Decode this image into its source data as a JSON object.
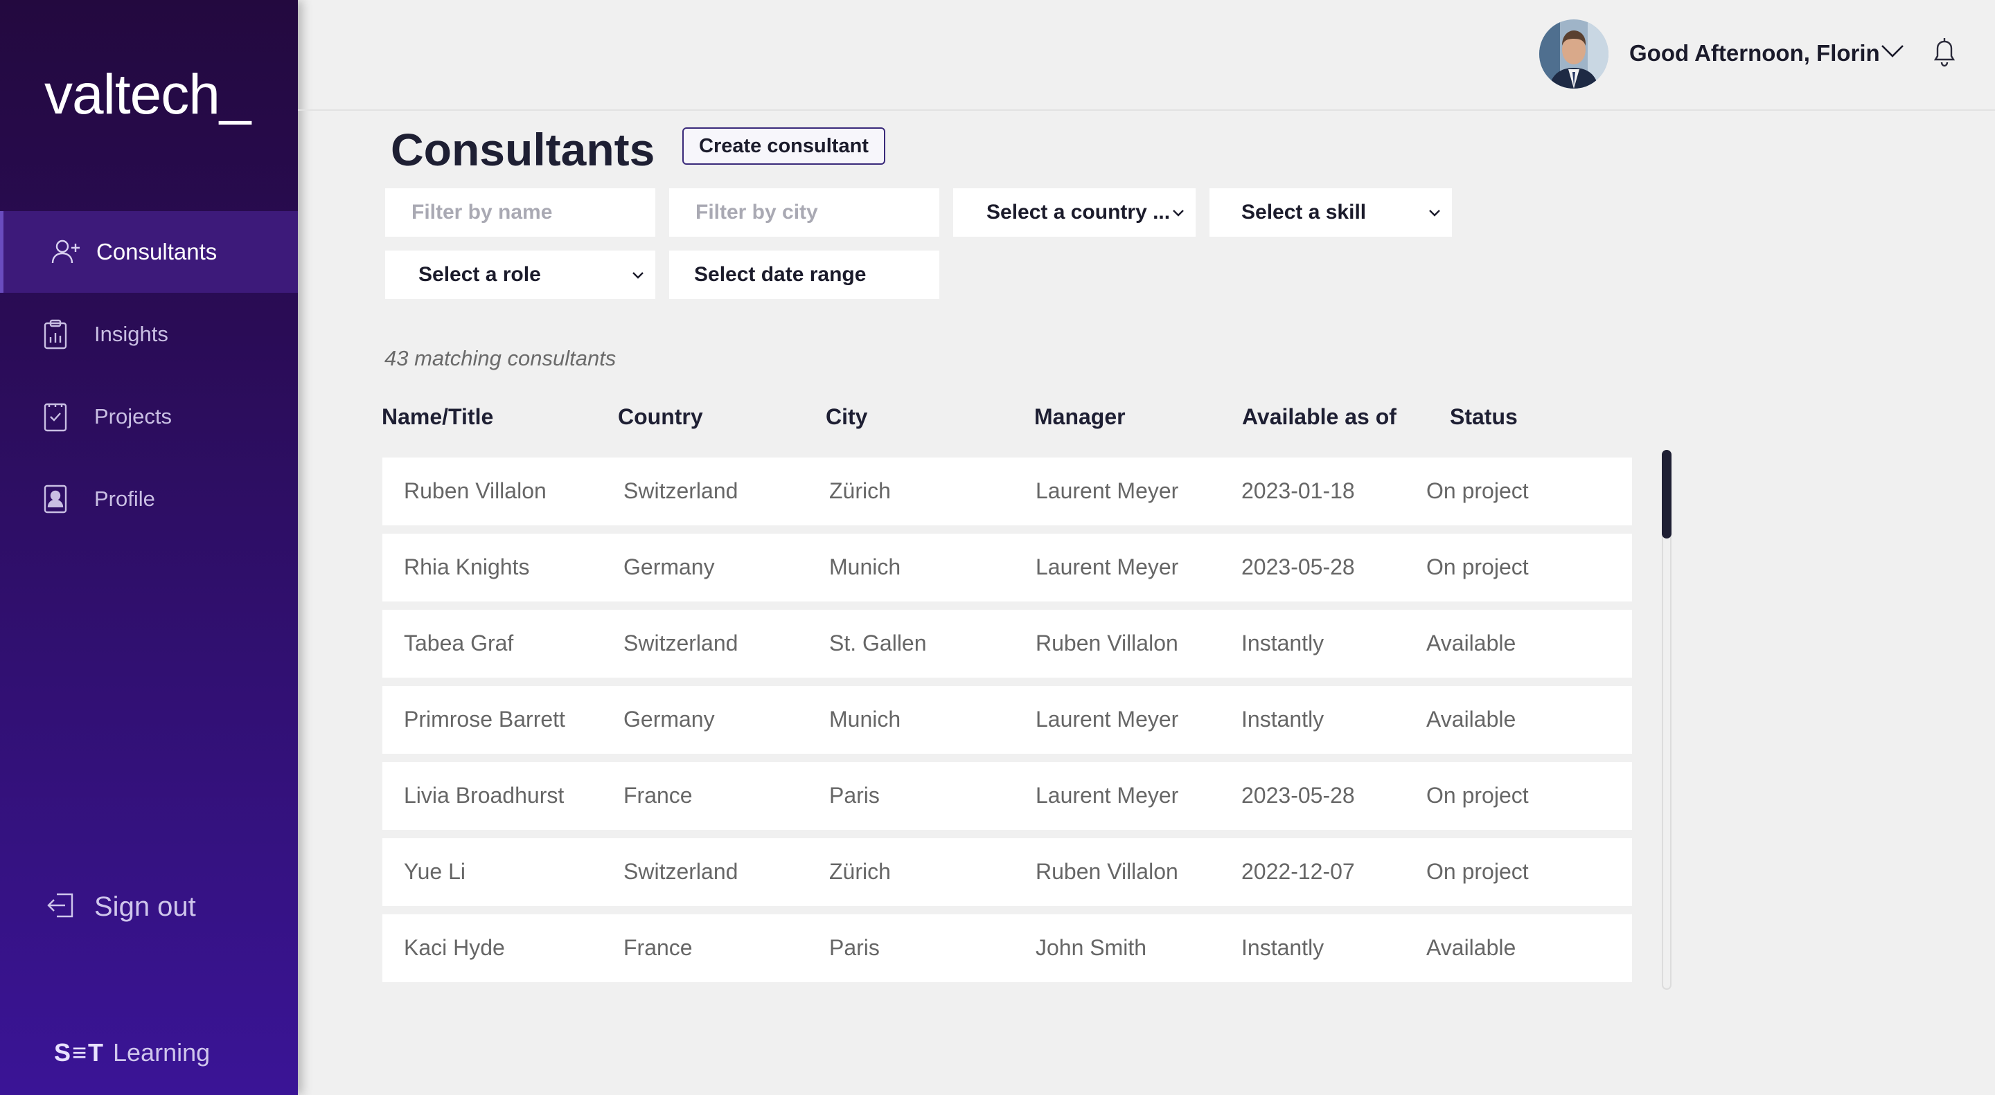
{
  "sidebar": {
    "logo": "valtech_",
    "items": [
      {
        "label": "Consultants",
        "icon": "user-plus-icon"
      },
      {
        "label": "Insights",
        "icon": "clipboard-chart-icon"
      },
      {
        "label": "Projects",
        "icon": "checklist-icon"
      },
      {
        "label": "Profile",
        "icon": "id-badge-icon"
      }
    ],
    "signout_label": "Sign out",
    "footer_brand_bold": "S≡T",
    "footer_brand_text": "Learning"
  },
  "header": {
    "greeting": "Good Afternoon, Florin"
  },
  "main": {
    "title": "Consultants",
    "create_button": "Create consultant",
    "filters": {
      "name_placeholder": "Filter by name",
      "city_placeholder": "Filter by city",
      "country": "Select a country ...",
      "skill": "Select a skill",
      "role": "Select a role",
      "date_range": "Select date range"
    },
    "count_text": "43 matching consultants",
    "columns": [
      "Name/Title",
      "Country",
      "City",
      "Manager",
      "Available as of",
      "Status"
    ],
    "rows": [
      [
        "Ruben Villalon",
        "Switzerland",
        "Zürich",
        "Laurent Meyer",
        "2023-01-18",
        "On project"
      ],
      [
        "Rhia Knights",
        "Germany",
        "Munich",
        "Laurent Meyer",
        "2023-05-28",
        "On project"
      ],
      [
        "Tabea Graf",
        "Switzerland",
        "St. Gallen",
        "Ruben Villalon",
        "Instantly",
        "Available"
      ],
      [
        "Primrose Barrett",
        "Germany",
        "Munich",
        "Laurent Meyer",
        "Instantly",
        "Available"
      ],
      [
        "Livia Broadhurst",
        "France",
        "Paris",
        "Laurent Meyer",
        "2023-05-28",
        "On project"
      ],
      [
        "Yue Li",
        "Switzerland",
        "Zürich",
        "Ruben Villalon",
        "2022-12-07",
        "On project"
      ],
      [
        "Kaci Hyde",
        "France",
        "Paris",
        "John Smith",
        "Instantly",
        "Available"
      ]
    ]
  },
  "colors": {
    "sidebar_top": "#23093f",
    "sidebar_bottom": "#3a1496",
    "active_item": "#3d1a7a",
    "background": "#f0f0f0",
    "text_dark": "#1e1f33"
  }
}
